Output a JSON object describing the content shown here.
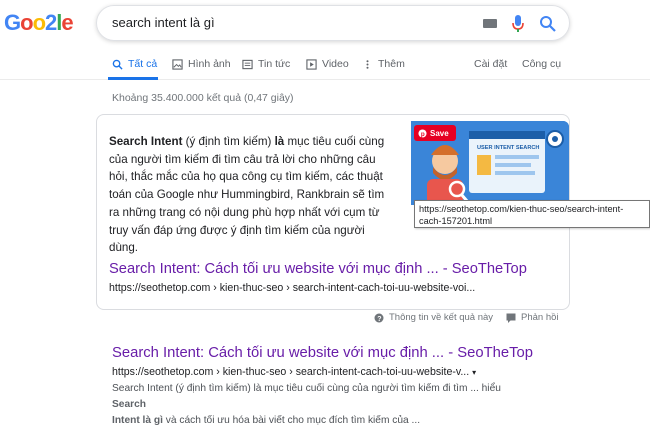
{
  "logo": {
    "l1": "G",
    "l2": "o",
    "l3": "o",
    "l4": "2",
    "l5": "l",
    "l6": "e"
  },
  "search": {
    "query": "search intent là gì"
  },
  "icons": {
    "keyboard": "keyboard-icon",
    "mic": "mic-icon",
    "search": "search-icon"
  },
  "tabs": [
    {
      "label": "Tất cả",
      "icon": "search-icon"
    },
    {
      "label": "Hình ảnh",
      "icon": "image-icon"
    },
    {
      "label": "Tin tức",
      "icon": "news-icon"
    },
    {
      "label": "Video",
      "icon": "video-icon"
    },
    {
      "label": "Thêm",
      "icon": "more-icon"
    }
  ],
  "tools": {
    "settings": "Cài đặt",
    "tools": "Công cụ"
  },
  "stats": "Khoảng 35.400.000 kết quả (0,47 giây)",
  "snippet": {
    "text_bold_1": "Search Intent",
    "text_1": " (ý định tìm kiếm) ",
    "text_bold_2": "là",
    "text_2": " mục tiêu cuối cùng của người tìm kiếm đi tìm câu trả lời cho những câu hỏi, thắc mắc của họ qua công cụ tìm kiếm, các thuật toán của Google như Hummingbird, Rankbrain sẽ tìm ra những trang có nội dung phù hợp nhất với cụm từ truy vấn đáp ứng được ý định tìm kiếm của người dùng.",
    "image_label": "USER INTENT SEARCH",
    "save_label": "Save",
    "tooltip": "https://seothetop.com/kien-thuc-seo/search-intent-cach-157201.html",
    "link_title": "Search Intent: Cách tối ưu website với mục định ... - SeoTheTop",
    "link_url": "https://seothetop.com › kien-thuc-seo › search-intent-cach-toi-uu-website-voi..."
  },
  "feedback": {
    "about": "Thông tin về kết quả này",
    "report": "Phản hồi"
  },
  "result": {
    "title": "Search Intent: Cách tối ưu website với mục định ... - SeoTheTop",
    "url": "https://seothetop.com › kien-thuc-seo › search-intent-cach-toi-uu-website-v...",
    "desc_1": "Search Intent (ý định tìm kiếm) là mục tiêu cuối cùng của người tìm kiếm đi tìm ... hiểu ",
    "desc_bold_1": "Search",
    "desc_bold_2": "Intent là gì",
    "desc_2": " và cách tối ưu hóa bài viết cho mục đích tìm kiếm của ..."
  },
  "colors": {
    "link_visited": "#681da8",
    "tab_active": "#1a73e8",
    "logo_blue": "#4285f4",
    "logo_red": "#ea4335",
    "logo_yellow": "#fbbc05",
    "logo_green": "#34a853"
  }
}
